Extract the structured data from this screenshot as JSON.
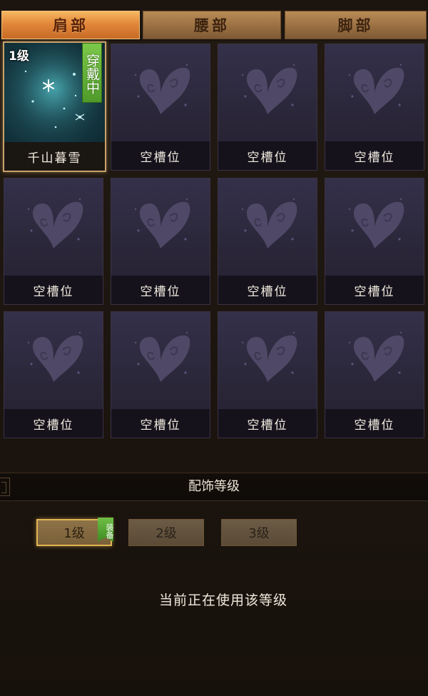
{
  "tabs": [
    {
      "label": "肩部",
      "active": true
    },
    {
      "label": "腰部",
      "active": false
    },
    {
      "label": "脚部",
      "active": false
    }
  ],
  "slots": [
    {
      "caption": "千山暮雪",
      "level": "1级",
      "wear": "穿戴中",
      "equipped": true,
      "icon": "snowflake-icon"
    },
    {
      "caption": "空槽位",
      "equipped": false,
      "icon": "butterfly-icon"
    },
    {
      "caption": "空槽位",
      "equipped": false,
      "icon": "butterfly-icon"
    },
    {
      "caption": "空槽位",
      "equipped": false,
      "icon": "butterfly-icon"
    },
    {
      "caption": "空槽位",
      "equipped": false,
      "icon": "butterfly-icon"
    },
    {
      "caption": "空槽位",
      "equipped": false,
      "icon": "butterfly-icon"
    },
    {
      "caption": "空槽位",
      "equipped": false,
      "icon": "butterfly-icon"
    },
    {
      "caption": "空槽位",
      "equipped": false,
      "icon": "butterfly-icon"
    },
    {
      "caption": "空槽位",
      "equipped": false,
      "icon": "butterfly-icon"
    },
    {
      "caption": "空槽位",
      "equipped": false,
      "icon": "butterfly-icon"
    },
    {
      "caption": "空槽位",
      "equipped": false,
      "icon": "butterfly-icon"
    },
    {
      "caption": "空槽位",
      "equipped": false,
      "icon": "butterfly-icon"
    }
  ],
  "section_title": "配饰等级",
  "levels": [
    {
      "label": "1级",
      "selected": true
    },
    {
      "label": "2级",
      "selected": false
    },
    {
      "label": "3级",
      "selected": false
    }
  ],
  "equip_tag": "装备",
  "status_text": "当前正在使用该等级",
  "colors": {
    "tab_active": "#e2883a",
    "tab_inactive": "#9d7244",
    "equip_green": "#4f9a2a",
    "selected_border": "#e2b552"
  }
}
